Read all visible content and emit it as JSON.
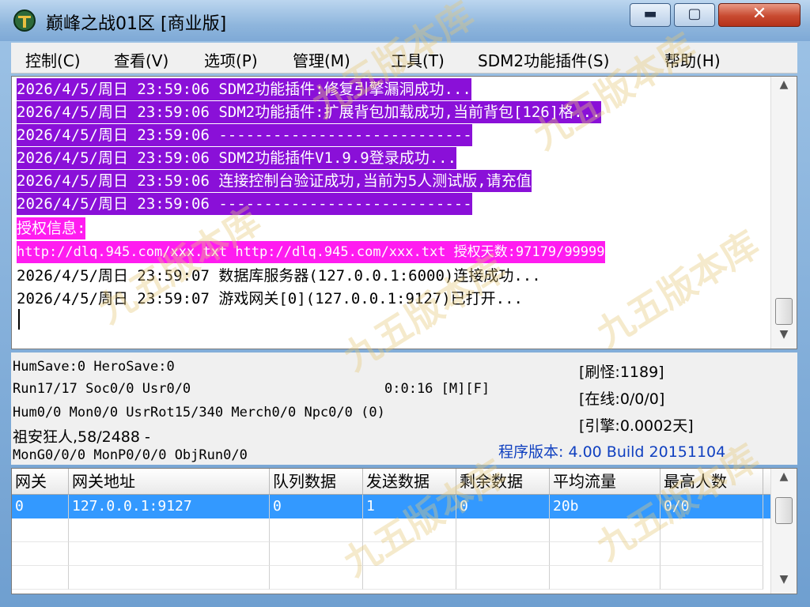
{
  "window": {
    "title": "巅峰之战01区 [商业版]",
    "controls": {
      "minimize": "▬",
      "maximize": "▢",
      "close": "✕"
    }
  },
  "menu": [
    "控制(C)",
    "查看(V)",
    "选项(P)",
    "管理(M)",
    "工具(T)",
    "SDM2功能插件(S)",
    "帮助(H)"
  ],
  "log": [
    {
      "text": "2026/4/5/周日 23:59:06 SDM2功能插件:修复引擎漏洞成功...",
      "style": "purple"
    },
    {
      "text": "2026/4/5/周日 23:59:06 SDM2功能插件:扩展背包加载成功,当前背包[126]格...",
      "style": "purple"
    },
    {
      "text": "2026/4/5/周日 23:59:06 ----------------------------",
      "style": "purple"
    },
    {
      "text": "2026/4/5/周日 23:59:06 SDM2功能插件V1.9.9登录成功...",
      "style": "purple"
    },
    {
      "text": "2026/4/5/周日 23:59:06 连接控制台验证成功,当前为5人测试版,请充值",
      "style": "purple"
    },
    {
      "text": "2026/4/5/周日 23:59:06 ----------------------------",
      "style": "purple"
    },
    {
      "text": "授权信息:",
      "style": "magenta"
    },
    {
      "text": "http://dlq.945.com/xxx.txt http://dlq.945.com/xxx.txt 授权天数:97179/99999",
      "style": "magenta"
    },
    {
      "text": "2026/4/5/周日 23:59:07 数据库服务器(127.0.0.1:6000)连接成功...",
      "style": "plain"
    },
    {
      "text": "2026/4/5/周日 23:59:07 游戏网关[0](127.0.0.1:9127)已打开...",
      "style": "plain"
    }
  ],
  "status": {
    "line1": "HumSave:0 HeroSave:0",
    "line2": "Run17/17 Soc0/0 Usr0/0",
    "uptime": "0:0:16 [M][F]",
    "line3": "Hum0/0 Mon0/0 UsrRot15/340 Merch0/0 Npc0/0 (0)",
    "line4": "祖安狂人,58/2488 -",
    "line5": "MonG0/0/0 MonP0/0/0 ObjRun0/0",
    "refresh": "[刷怪:1189]",
    "online": "[在线:0/0/0]",
    "engine": "[引擎:0.0002天]",
    "version": "程序版本: 4.00 Build 20151104"
  },
  "table": {
    "columns": [
      "网关",
      "网关地址",
      "队列数据",
      "发送数据",
      "剩余数据",
      "平均流量",
      "最高人数"
    ],
    "rows": [
      [
        "0",
        "127.0.0.1:9127",
        "0",
        "1",
        "0",
        "20b",
        "0/0"
      ]
    ]
  },
  "watermark": "九五版本库",
  "colors": {
    "log_purple": "#8a10d8",
    "log_magenta": "#ff1cf0",
    "selection": "#3399ff",
    "version_text": "#1040c0"
  }
}
